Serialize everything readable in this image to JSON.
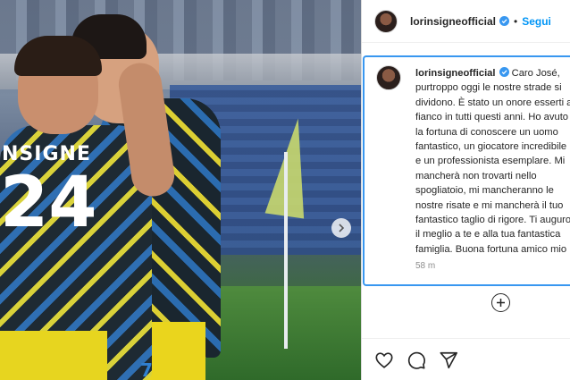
{
  "post": {
    "username": "lorinsigneofficial",
    "follow_label": "Segui",
    "separator": "•",
    "caption_text": "Caro José, purtroppo oggi le nostre strade si dividono. È stato un onore esserti al fianco in tutti questi anni. Ho avuto la fortuna di conoscere un uomo fantastico, un giocatore incredibile e un professionista esemplare. Mi mancherà non trovarti nello spogliatoio, mi mancheranno le nostre risate e mi mancherà il tuo fantastico taglio di rigore. Ti auguro il meglio a te e alla tua fantastica famiglia. Buona fortuna amico mio 💙",
    "time": "58 m"
  },
  "photo": {
    "shirt_name": "NSIGNE",
    "shirt_number": "24",
    "shorts_number": "7"
  },
  "icons": {
    "verified": "verified-badge-icon",
    "add": "add-circle-icon",
    "like": "heart-icon",
    "comment": "comment-bubble-icon",
    "share": "paper-plane-icon",
    "next": "chevron-right-icon"
  },
  "colors": {
    "accent": "#0095f6",
    "focus_border": "#3897f0",
    "text": "#262626",
    "muted": "#8e8e8e"
  }
}
